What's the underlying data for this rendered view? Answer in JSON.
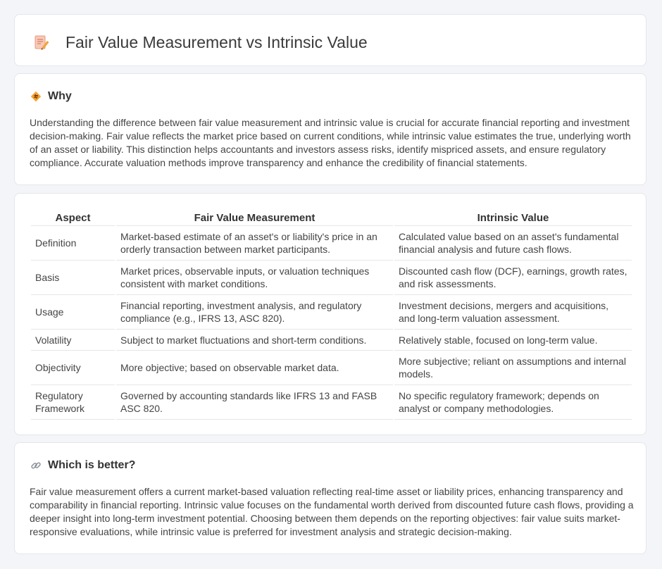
{
  "header": {
    "title": "Fair Value Measurement vs Intrinsic Value",
    "icon": "document-pencil-icon"
  },
  "why": {
    "title": "Why",
    "icon": "diamond-arrows-icon",
    "body": "Understanding the difference between fair value measurement and intrinsic value is crucial for accurate financial reporting and investment decision-making. Fair value reflects the market price based on current conditions, while intrinsic value estimates the true, underlying worth of an asset or liability. This distinction helps accountants and investors assess risks, identify mispriced assets, and ensure regulatory compliance. Accurate valuation methods improve transparency and enhance the credibility of financial statements."
  },
  "table": {
    "headers": [
      "Aspect",
      "Fair Value Measurement",
      "Intrinsic Value"
    ],
    "rows": [
      [
        "Definition",
        "Market-based estimate of an asset's or liability's price in an orderly transaction between market participants.",
        "Calculated value based on an asset's fundamental financial analysis and future cash flows."
      ],
      [
        "Basis",
        "Market prices, observable inputs, or valuation techniques consistent with market conditions.",
        "Discounted cash flow (DCF), earnings, growth rates, and risk assessments."
      ],
      [
        "Usage",
        "Financial reporting, investment analysis, and regulatory compliance (e.g., IFRS 13, ASC 820).",
        "Investment decisions, mergers and acquisitions, and long-term valuation assessment."
      ],
      [
        "Volatility",
        "Subject to market fluctuations and short-term conditions.",
        "Relatively stable, focused on long-term value."
      ],
      [
        "Objectivity",
        "More objective; based on observable market data.",
        "More subjective; reliant on assumptions and internal models."
      ],
      [
        "Regulatory Framework",
        "Governed by accounting standards like IFRS 13 and FASB ASC 820.",
        "No specific regulatory framework; depends on analyst or company methodologies."
      ]
    ]
  },
  "better": {
    "title": "Which is better?",
    "icon": "link-icon",
    "body": "Fair value measurement offers a current market-based valuation reflecting real-time asset or liability prices, enhancing transparency and comparability in financial reporting. Intrinsic value focuses on the fundamental worth derived from discounted future cash flows, providing a deeper insight into long-term investment potential. Choosing between them depends on the reporting objectives: fair value suits market-responsive evaluations, while intrinsic value is preferred for investment analysis and strategic decision-making."
  }
}
